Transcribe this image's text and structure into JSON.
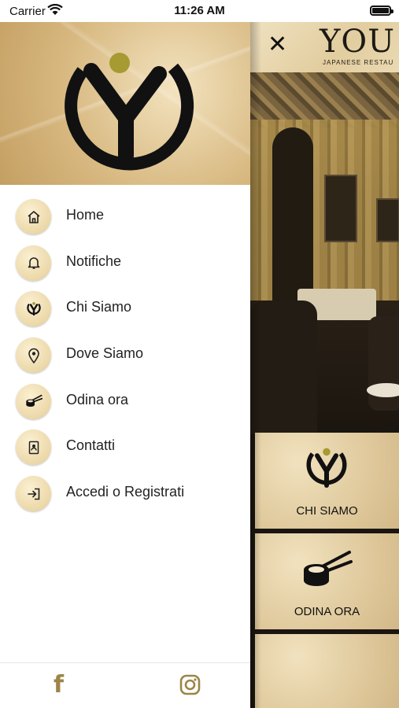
{
  "status_bar": {
    "carrier": "Carrier",
    "time": "11:26 AM"
  },
  "background_app": {
    "brand": "YOU",
    "brand_subtitle": "JAPANESE RESTAU",
    "tiles": [
      {
        "label": "CHI SIAMO",
        "icon": "logo-icon"
      },
      {
        "label": "ODINA ORA",
        "icon": "sushi-chopsticks-icon"
      }
    ]
  },
  "drawer": {
    "menu": [
      {
        "label": "Home",
        "icon": "home-icon"
      },
      {
        "label": "Notifiche",
        "icon": "bell-icon"
      },
      {
        "label": "Chi Siamo",
        "icon": "logo-icon"
      },
      {
        "label": "Dove Siamo",
        "icon": "location-pin-icon"
      },
      {
        "label": "Odina ora",
        "icon": "sushi-chopsticks-icon"
      },
      {
        "label": "Contatti",
        "icon": "contact-book-icon"
      },
      {
        "label": "Accedi o Registrati",
        "icon": "login-icon"
      }
    ],
    "footer": {
      "facebook": "f",
      "icons": [
        "facebook-icon",
        "instagram-icon"
      ]
    }
  },
  "colors": {
    "accent_gold": "#9c8546",
    "logo_dot": "#a69a33",
    "text": "#222222"
  }
}
